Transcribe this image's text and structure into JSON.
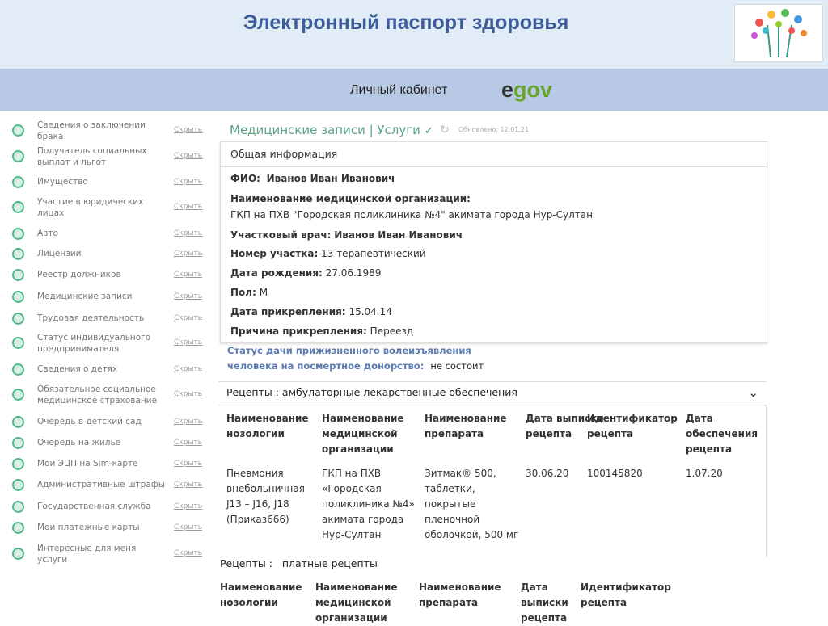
{
  "header": {
    "title": "Электронный паспорт здоровья",
    "cabinet": "Личный кабинет",
    "egov_logo": "egov"
  },
  "sidebar": {
    "hide_label": "Скрыть",
    "items": [
      "Сведения о заключении брака",
      "Получатель социальных выплат и льгот",
      "Имущество",
      "Участие в юридических лицах",
      "Авто",
      "Лицензии",
      "Реестр должников",
      "Медицинские записи",
      "Трудовая деятельность",
      "Статус индивидуального предпринимателя",
      "Сведения о детях",
      "Обязательное социальное медицинское страхование",
      "Очередь в детский сад",
      "Очередь на жилье",
      "Мои ЭЦП на Sim-карте",
      "Административные штрафы",
      "Государственная служба",
      "Мои платежные карты",
      "Интересные для меня услуги"
    ]
  },
  "main": {
    "heading": "Медицинские записи | Услуги",
    "updated": "Обновлено: 12.01.21",
    "general": {
      "title": "Общая информация",
      "fio_label": "ФИО:",
      "fio": "Иванов Иван Иванович",
      "org_label": "Наименование медицинской организации:",
      "org": "ГКП на ПХВ \"Городская поликлиника №4\" акимата города Нур-Султан",
      "doctor_label": "Участковый врач:",
      "doctor": "Иванов Иван Иванович",
      "area_label": "Номер участка:",
      "area": "13 терапевтический",
      "birth_label": "Дата рождения:",
      "birth": "27.06.1989",
      "sex_label": "Пол:",
      "sex": "М",
      "attach_label": "Дата прикрепления:",
      "attach": "15.04.14",
      "reason_label": "Причина прикрепления:",
      "reason": "Переезд"
    },
    "donor": {
      "label": "Статус дачи прижизненного волеизъявления человека на посмертное донорство:",
      "value": "не состоит"
    },
    "recipes1": {
      "label": "Рецепты :",
      "value": "амбулаторные лекарственные обеспечения",
      "headers": [
        "Наименование нозологии",
        "Наименование медицинской организации",
        "Наименование препарата",
        "Дата выписки рецепта",
        "Идентификатор рецепта",
        "Дата обеспечения рецепта"
      ],
      "row": [
        "Пневмония внебольничная J13 – J16, J18 (Приказ666)",
        "ГКП на ПХВ «Городская поликлиника №4» акимата города Нур-Султан",
        "Зитмак® 500, таблетки, покрытые пленочной оболочкой, 500 мг",
        "30.06.20",
        "100145820",
        "1.07.20"
      ]
    },
    "recipes2": {
      "label": "Рецепты :",
      "value": "платные рецепты",
      "headers": [
        "Наименование нозологии",
        "Наименование медицинской организации",
        "Наименование препарата",
        "Дата выписки рецепта",
        "Идентификатор рецепта"
      ]
    }
  }
}
